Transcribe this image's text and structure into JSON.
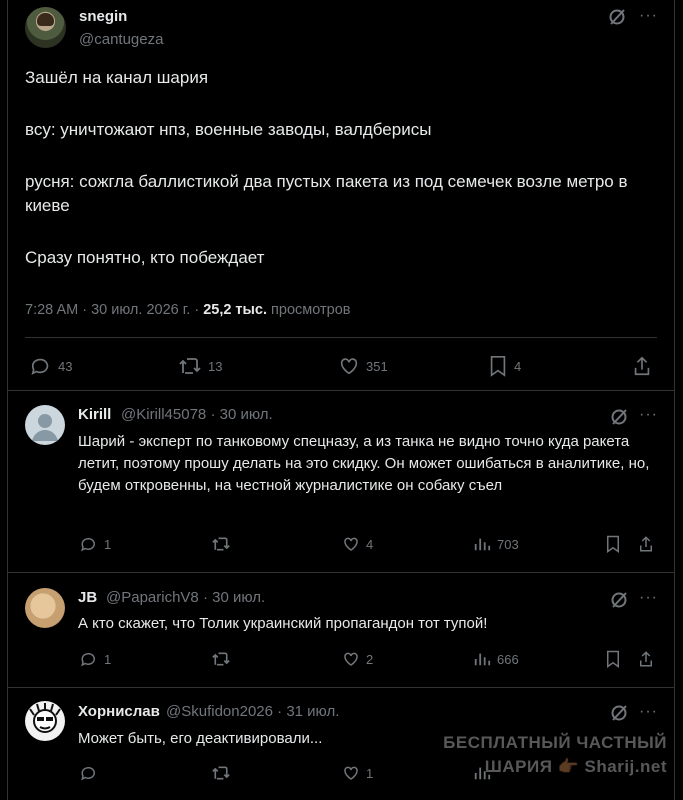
{
  "tweet": {
    "author_name": "snegin",
    "author_handle": "@cantugeza",
    "paragraphs": [
      "Зашёл на канал шария",
      "всу: уничтожают нпз, военные заводы, валдберисы",
      "русня: сожгла баллистикой два пустых пакета из под семечек  возле метро в киеве",
      "Сразу понятно, кто побеждает"
    ],
    "time": "7:28 AM",
    "date": "30 июл. 2026 г.",
    "views": "25,2 тыс.",
    "views_label": "просмотров",
    "replies": "43",
    "retweets": "13",
    "likes": "351",
    "bookmarks": "4"
  },
  "replies": [
    {
      "name": "Kirill",
      "handle": "@Kirill45078",
      "date": "30 июл.",
      "text": "Шарий - эксперт по танковому спецназу, а из танка не видно точно куда ракета летит, поэтому прошу делать на это скидку. Он может ошибаться в аналитике, но, будем откровенны, на честной журналистике он собаку съел",
      "reply_count": "1",
      "retweet_count": "",
      "like_count": "4",
      "views": "703"
    },
    {
      "name": "JB",
      "handle": "@PaparichV8",
      "date": "30 июл.",
      "text": "А кто скажет, что Толик украинский пропагандон тот тупой!",
      "reply_count": "1",
      "retweet_count": "",
      "like_count": "2",
      "views": "666"
    },
    {
      "name": "Хорнислав",
      "handle": "@Skufidon2026",
      "date": "31 июл.",
      "text": "Может быть, его деактивировали...",
      "reply_count": "",
      "retweet_count": "",
      "like_count": "1",
      "views": ""
    }
  ],
  "watermark": {
    "line1": "БЕСПЛАТНЫЙ ЧАСТНЫЙ",
    "line2": "ШАРИЯ 👉🏾 Sharij.net"
  },
  "sep": "·",
  "more": "···",
  "colors": {
    "bg": "#000000",
    "text": "#e7e9ea",
    "muted": "#71767b",
    "border": "#2f3336"
  },
  "icons": [
    "grok-icon",
    "more-icon",
    "reply-icon",
    "retweet-icon",
    "like-icon",
    "bookmark-icon",
    "share-icon",
    "views-icon"
  ]
}
